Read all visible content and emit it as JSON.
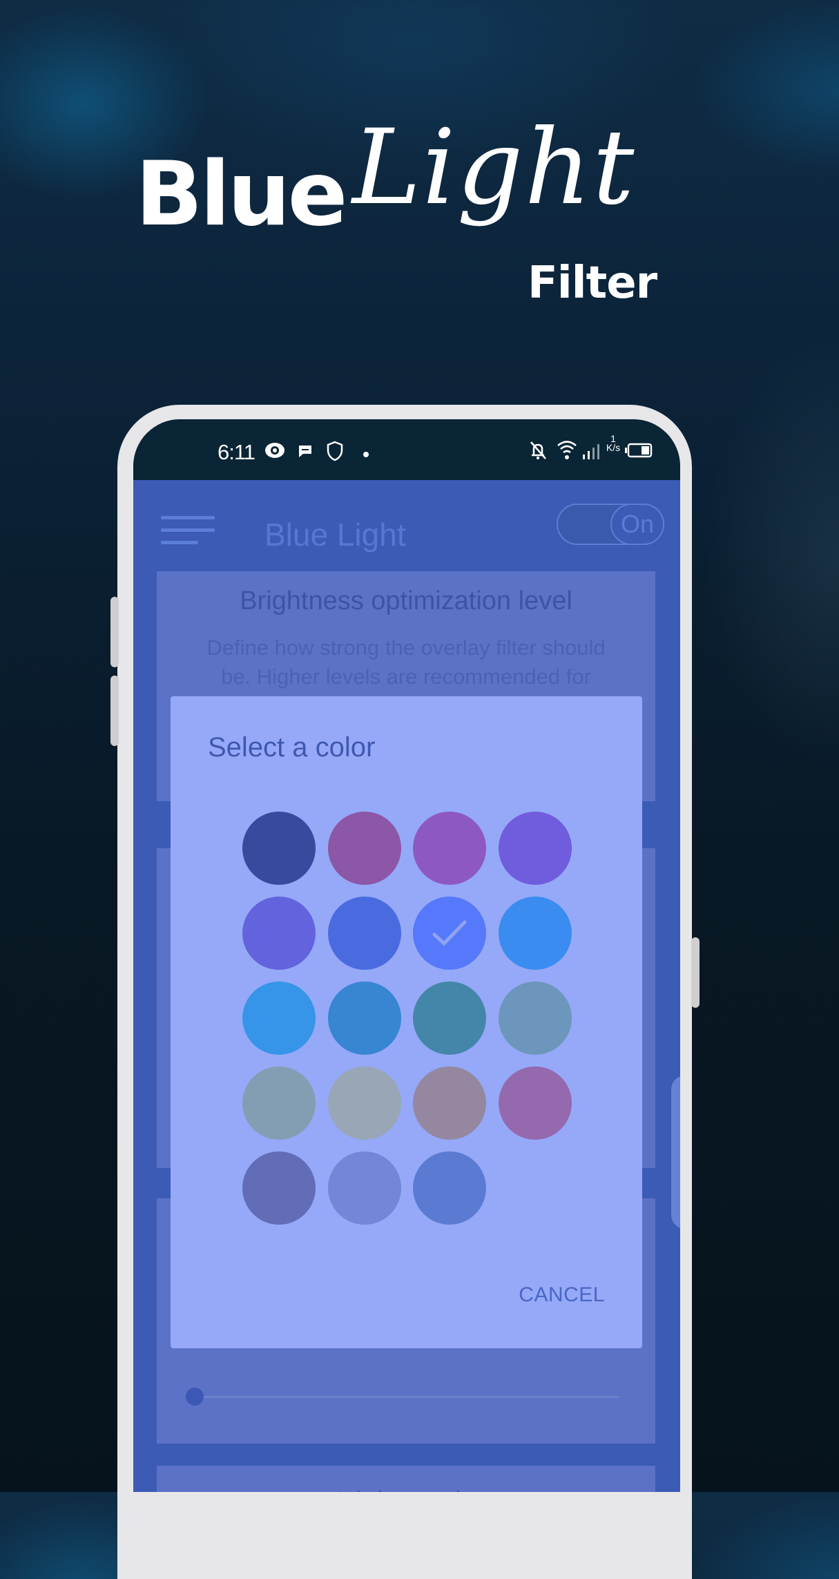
{
  "hero": {
    "word1": "Blue",
    "word2": "Light",
    "word3": "Filter"
  },
  "status_bar": {
    "time": "6:11",
    "left_icons": [
      "eye-icon",
      "message-icon",
      "shield-icon",
      "dot-icon"
    ],
    "right_icons": [
      "bell-off-icon",
      "wifi-icon",
      "signal-icon",
      "network-speed",
      "battery-icon"
    ],
    "network_speed_value": "1",
    "network_speed_unit": "K/s"
  },
  "app_bar": {
    "menu_icon": "hamburger-menu-icon",
    "title": "Blue Light",
    "toggle_label": "On",
    "toggle_state": true
  },
  "background_cards": [
    {
      "title": "Brightness optimization level",
      "description_line1": "Define how strong the overlay filter should",
      "description_line2": "be. Higher levels are recommended for"
    },
    {
      "title": ""
    },
    {
      "title": "",
      "slider_value": 0
    },
    {
      "title": "Night mode"
    }
  ],
  "dialog": {
    "title": "Select a color",
    "cancel_label": "CANCEL",
    "selected_index": 6,
    "swatches": [
      {
        "color": "#364a9e"
      },
      {
        "color": "#8b57a6"
      },
      {
        "color": "#8e58c2"
      },
      {
        "color": "#705ddd"
      },
      {
        "color": "#6263dd"
      },
      {
        "color": "#4a6be0"
      },
      {
        "color": "#5679fb"
      },
      {
        "color": "#3a8cf0"
      },
      {
        "color": "#3695e8"
      },
      {
        "color": "#3885d1"
      },
      {
        "color": "#4486a9"
      },
      {
        "color": "#6c96bc"
      },
      {
        "color": "#839db3"
      },
      {
        "color": "#98a6b6"
      },
      {
        "color": "#94879f"
      },
      {
        "color": "#9469ae"
      },
      {
        "color": "#636cb6"
      },
      {
        "color": "#7386d8"
      },
      {
        "color": "#5b7bd3"
      }
    ]
  }
}
